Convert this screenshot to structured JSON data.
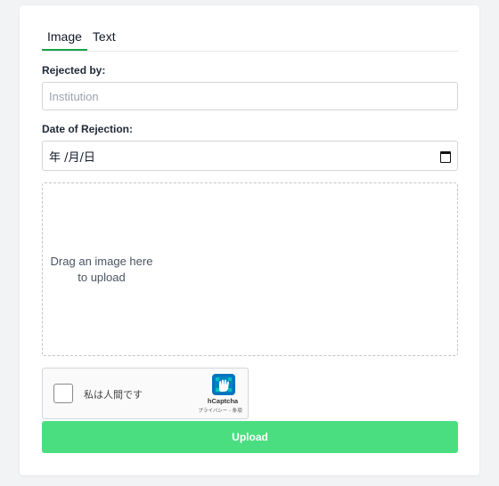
{
  "tabs": [
    {
      "label": "Image",
      "active": true
    },
    {
      "label": "Text",
      "active": false
    }
  ],
  "form": {
    "rejected_by_label": "Rejected by:",
    "rejected_by_placeholder": "Institution",
    "date_label": "Date of Rejection:",
    "date_value": "年 /月/日",
    "date_icon": "calendar-icon"
  },
  "dropzone": {
    "text_line1": "Drag an image here",
    "text_line2": "to upload"
  },
  "captcha": {
    "label": "私は人間です",
    "brand": "hCaptcha",
    "links": "プライバシー - 条項"
  },
  "upload": {
    "label": "Upload",
    "color": "#4ade80"
  },
  "colors": {
    "accent": "#16a34a",
    "background": "#f2f3f5"
  }
}
